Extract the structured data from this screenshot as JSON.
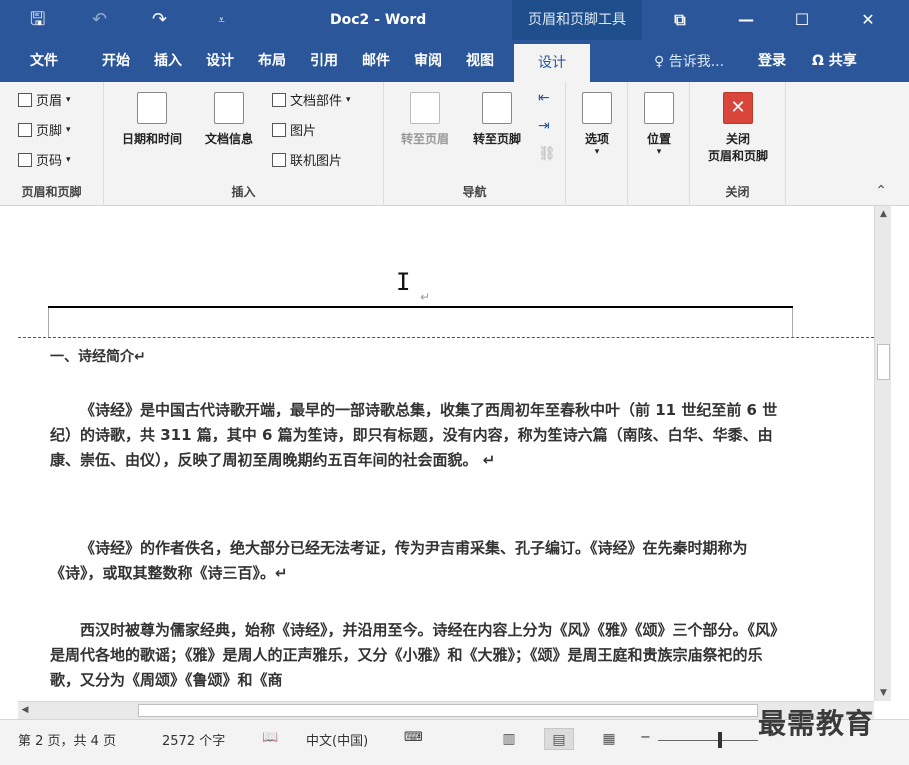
{
  "titlebar": {
    "save_glyph": "🖫",
    "undo_glyph": "↶",
    "redo_glyph": "↷",
    "customize_glyph": "⩡",
    "doc_title": "Doc2 - Word",
    "context_tab": "页眉和页脚工具",
    "restore_glyph": "⧉",
    "minimize_glyph": "—",
    "maximize_glyph": "☐",
    "close_glyph": "✕"
  },
  "tabs": [
    "文件",
    "开始",
    "插入",
    "设计",
    "布局",
    "引用",
    "邮件",
    "审阅",
    "视图"
  ],
  "active_tab": "设计",
  "tell_me": "♀ 告诉我...",
  "login": "登录",
  "share": "Ω 共享",
  "ribbon": {
    "group1": {
      "items": [
        "页眉",
        "页脚",
        "页码"
      ],
      "label": "页眉和页脚"
    },
    "group2": {
      "datetime": "日期和时间",
      "docinfo": "文档信息",
      "docparts": "文档部件",
      "picture": "图片",
      "online_picture": "联机图片",
      "label": "插入"
    },
    "group3": {
      "prev": "转至页眉",
      "next": "转至页脚",
      "label": "导航"
    },
    "group4": {
      "options": "选项",
      "position": "位置"
    },
    "group5": {
      "close_line1": "关闭",
      "close_line2": "页眉和页脚",
      "label": "关闭"
    }
  },
  "document": {
    "para_mark": "↵",
    "heading": "一、诗经简介↵",
    "paragraphs": [
      "《诗经》是中国古代诗歌开端，最早的一部诗歌总集，收集了西周初年至春秋中叶（前 11 世纪至前 6 世纪）的诗歌，共 311 篇，其中 6 篇为笙诗，即只有标题，没有内容，称为笙诗六篇（南陔、白华、华黍、由康、崇伍、由仪），反映了周初至周晚期约五百年间的社会面貌。 ↵",
      "《诗经》的作者佚名，绝大部分已经无法考证，传为尹吉甫采集、孔子编订。《诗经》在先秦时期称为《诗》，或取其整数称《诗三百》。↵",
      "西汉时被尊为儒家经典，始称《诗经》，并沿用至今。诗经在内容上分为《风》《雅》《颂》三个部分。《风》是周代各地的歌谣；《雅》是周人的正声雅乐，又分《小雅》和《大雅》；《颂》是周王庭和贵族宗庙祭祀的乐歌，又分为《周颂》《鲁颂》和《商"
    ]
  },
  "statusbar": {
    "page": "第 2 页，共 4 页",
    "words": "2572 个字",
    "proof_icon": "📖",
    "language": "中文(中国)",
    "macro_icon": "⌨"
  },
  "watermark": "最需教育"
}
